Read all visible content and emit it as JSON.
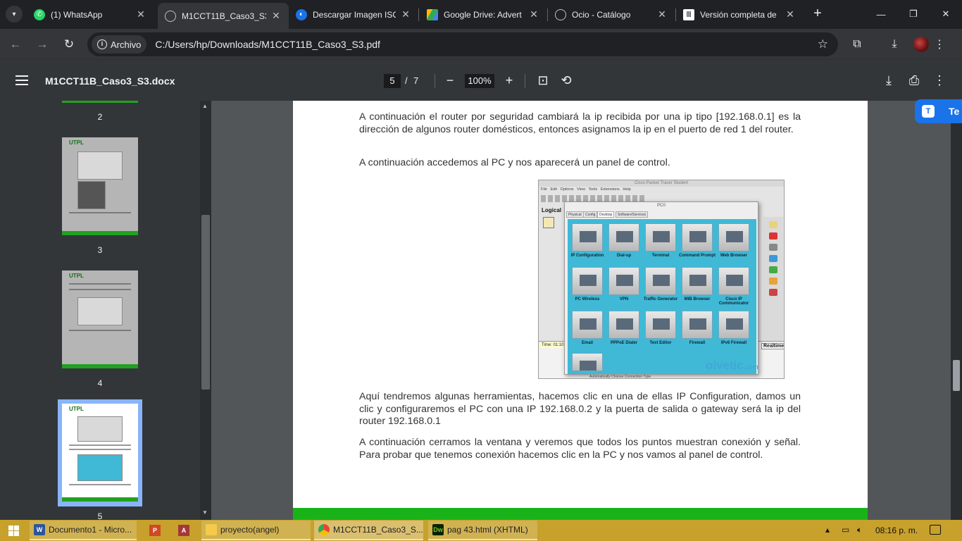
{
  "browser": {
    "tabs": [
      {
        "title": "(1) WhatsApp",
        "icon": "whatsapp-icon",
        "active": false
      },
      {
        "title": "M1CCT11B_Caso3_S3",
        "icon": "globe-icon",
        "active": true
      },
      {
        "title": "Descargar Imagen ISO",
        "icon": "download-site-icon",
        "active": false
      },
      {
        "title": "Google Drive: Advert",
        "icon": "google-drive-icon",
        "active": false
      },
      {
        "title": "Ocio - Catálogo",
        "icon": "globe-icon",
        "active": false
      },
      {
        "title": "Versión completa de",
        "icon": "library-icon",
        "active": false
      }
    ],
    "new_tab": "+",
    "omnibox": {
      "chip_label": "Archivo",
      "url": "C:/Users/hp/Downloads/M1CCT11B_Caso3_S3.pdf"
    }
  },
  "pdf": {
    "title": "M1CCT11B_Caso3_S3.docx",
    "current_page": "5",
    "separator": "/",
    "total_pages": "7",
    "zoom": "100%",
    "thumbnails": [
      {
        "label": "2"
      },
      {
        "label": "3"
      },
      {
        "label": "4"
      },
      {
        "label": "5"
      }
    ],
    "translate_label": "Te"
  },
  "document": {
    "paragraphs": [
      "A continuación el router por seguridad cambiará la ip recibida por una ip tipo [192.168.0.1] es la dirección de algunos router domésticos, entonces asignamos la ip en el puerto de red 1 del router.",
      "A continuación accedemos al PC y nos aparecerá un panel de control.",
      "Aquí tendremos algunas herramientas, hacemos clic en una de ellas IP Configuration, damos un clic y configuraremos el PC con una IP 192.168.0.2 y la puerta de salida o gateway será la ip del router 192.168.0.1",
      "A continuación cerramos la ventana y veremos que todos los puntos muestran conexión y señal. Para probar que tenemos conexión hacemos clic en la PC y nos vamos al panel de control."
    ],
    "screenshot": {
      "app_title": "Cisco Packet Tracer Student",
      "menu": [
        "File",
        "Edit",
        "Options",
        "View",
        "Tools",
        "Extensions",
        "Help"
      ],
      "logical": "Logical",
      "time": "Time: 01:10:",
      "realtime": "Realtime",
      "bottom_text": "Automatically Choose Connection Type",
      "window_title": "PC0",
      "tabs": [
        "Physical",
        "Config",
        "Desktop",
        "Software/Services"
      ],
      "apps": [
        "IP Configuration",
        "Dial-up",
        "Terminal",
        "Command Prompt",
        "Web Browser",
        "PC Wireless",
        "VPN",
        "Traffic Generator",
        "MIB Browser",
        "Cisco IP Communicator",
        "Email",
        "PPPoE Dialer",
        "Text Editor",
        "Firewall",
        "IPv6 Firewall"
      ],
      "watermark": "olvetic",
      "watermark_suffix": ".com"
    }
  },
  "taskbar": {
    "items": [
      {
        "label": "Documento1 - Micro...",
        "icon": "word-icon"
      },
      {
        "label": "proyecto(angel)",
        "icon": "folder-icon"
      },
      {
        "label": "M1CCT11B_Caso3_S...",
        "icon": "chrome-icon"
      },
      {
        "label": "pag 43.html (XHTML)",
        "icon": "dreamweaver-icon"
      }
    ],
    "clock": "08:16 p. m."
  },
  "colors": {
    "accent_green": "#19b319",
    "selected_thumb": "#8ab4f8",
    "taskbar": "#c7a12c"
  }
}
